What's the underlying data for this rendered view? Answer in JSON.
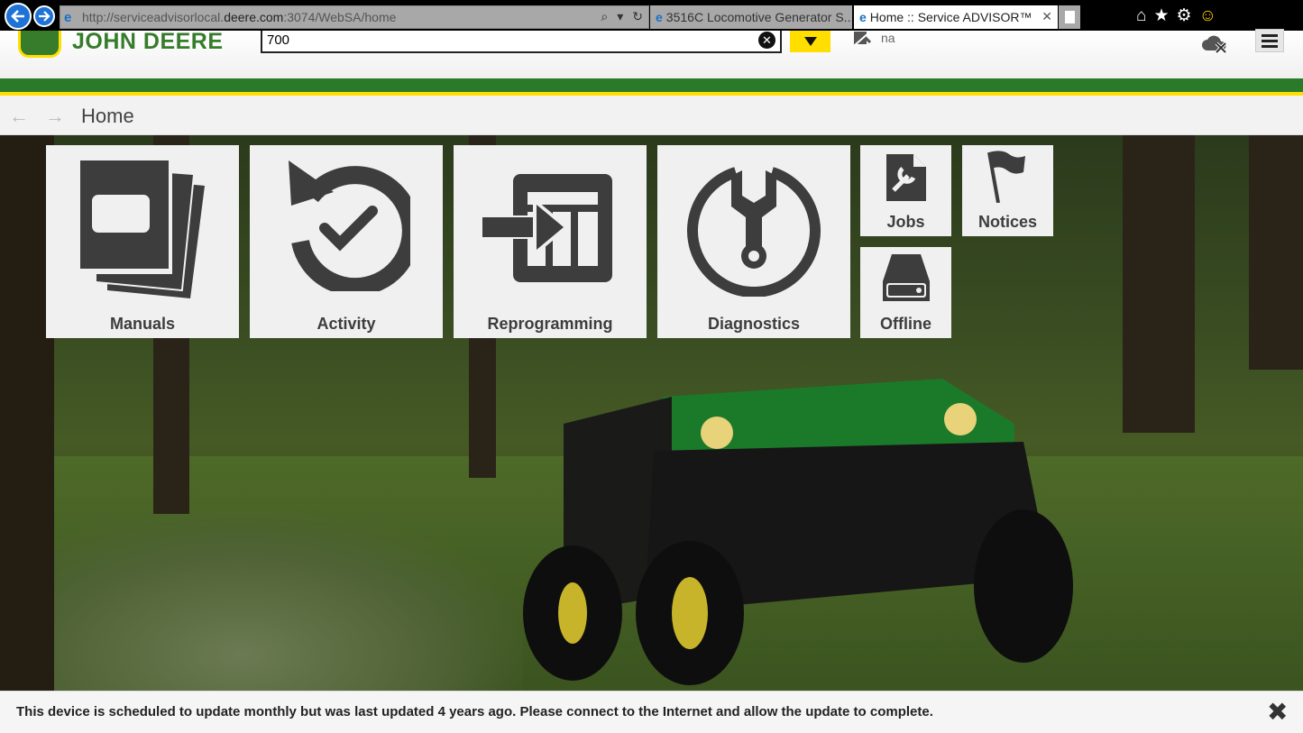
{
  "browser": {
    "url_prefix": "http://serviceadvisorlocal.",
    "url_domain": "deere.com",
    "url_suffix": ":3074/WebSA/home",
    "tabs": [
      {
        "label": "3516C Locomotive Generator S..."
      },
      {
        "label": "Home :: Service ADVISOR™"
      }
    ]
  },
  "header": {
    "brand": "JOHN DEERE",
    "search_value": "700",
    "user": "na"
  },
  "breadcrumb": {
    "title": "Home"
  },
  "tiles": {
    "manuals": "Manuals",
    "activity": "Activity",
    "reprogramming": "Reprogramming",
    "diagnostics": "Diagnostics",
    "jobs": "Jobs",
    "notices": "Notices",
    "offline": "Offline"
  },
  "notification": {
    "message": "This device is scheduled to update monthly but was last updated 4 years ago. Please connect to the Internet and allow the update to complete."
  },
  "colors": {
    "brand_green": "#367c2b",
    "brand_yellow": "#ffde00",
    "tile_bg": "#f0f0f0",
    "icon_dark": "#3d3d3d"
  }
}
